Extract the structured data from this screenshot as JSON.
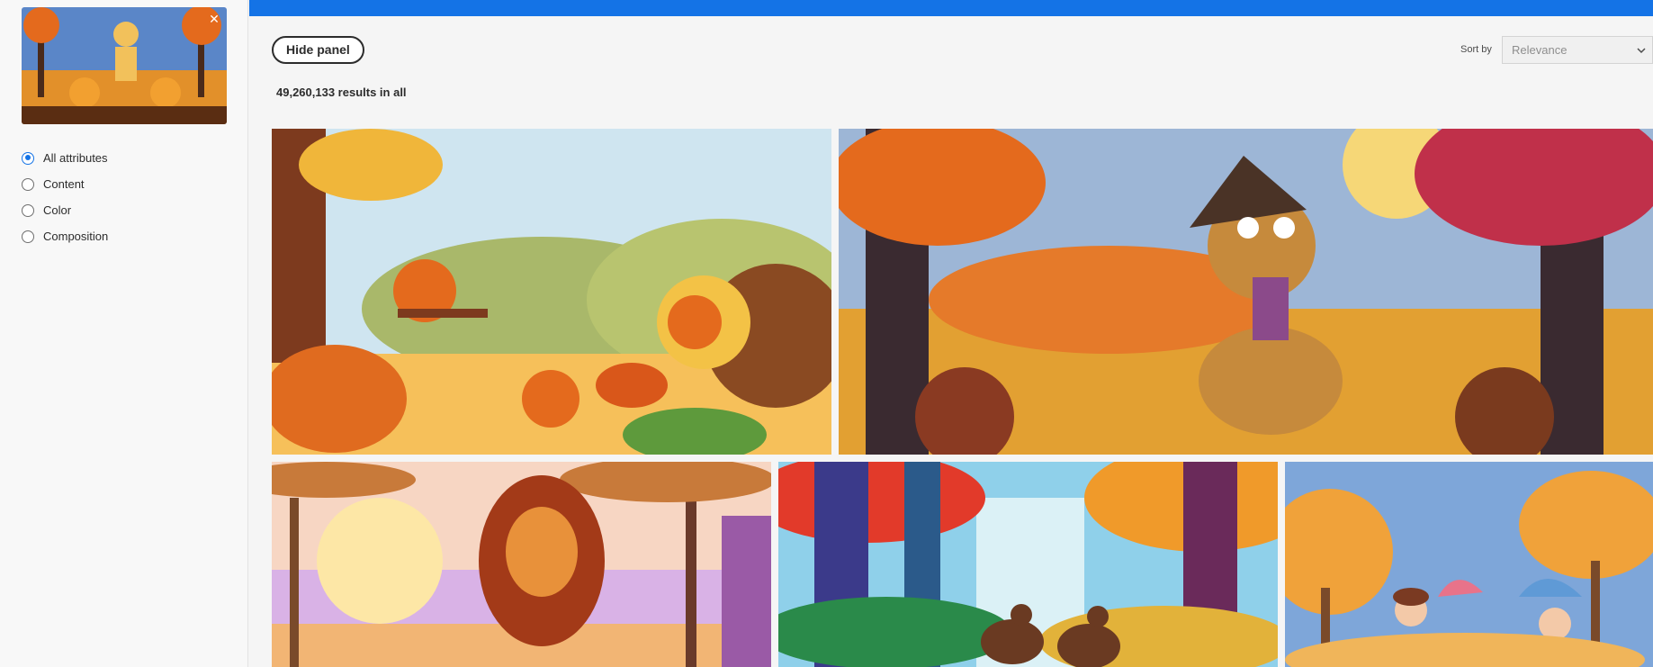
{
  "reference": {
    "close_symbol": "✕"
  },
  "attributes": [
    {
      "label": "All attributes",
      "checked": true
    },
    {
      "label": "Content",
      "checked": false
    },
    {
      "label": "Color",
      "checked": false
    },
    {
      "label": "Composition",
      "checked": false
    }
  ],
  "toolbar": {
    "hide_panel_label": "Hide panel",
    "sort_by_label": "Sort by",
    "sort_value": "Relevance"
  },
  "results_text": "49,260,133 results in all",
  "colors": {
    "accent": "#1473e6"
  },
  "images": [
    {
      "subject": "squirrels-autumn"
    },
    {
      "subject": "dog-witch-hat-autumn"
    },
    {
      "subject": "lion-savanna"
    },
    {
      "subject": "deer-autumn-forest"
    },
    {
      "subject": "children-umbrella-autumn"
    }
  ]
}
